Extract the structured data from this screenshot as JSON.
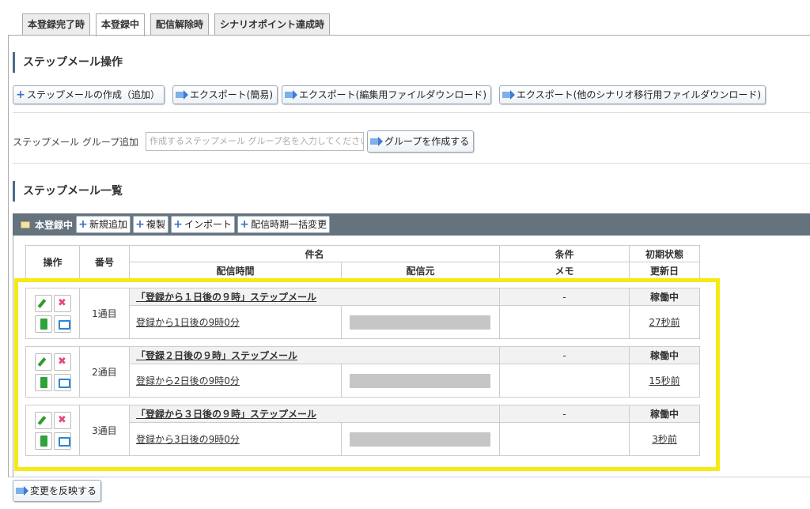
{
  "tabs": [
    "本登録完了時",
    "本登録中",
    "配信解除時",
    "シナリオポイント達成時"
  ],
  "active_tab": "本登録中",
  "ops_section": {
    "title": "ステップメール操作",
    "create_btn": "ステップメールの作成（追加）",
    "export_simple_btn": "エクスポート(簡易)",
    "export_edit_btn": "エクスポート(編集用ファイルダウンロード)",
    "export_other_btn": "エクスポート(他のシナリオ移行用ファイルダウンロード)"
  },
  "group": {
    "label": "ステップメール グループ追加",
    "placeholder": "作成するステップメール グループ名を入力してください",
    "create_btn": "グループを作成する"
  },
  "list_section": {
    "title": "ステップメール一覧",
    "group_name": "本登録中",
    "add_btn": "新規追加",
    "copy_btn": "複製",
    "import_btn": "インポート",
    "bulk_btn": "配信時期一括変更"
  },
  "table": {
    "h_ops": "操作",
    "h_num": "番号",
    "h_subject": "件名",
    "h_cond": "条件",
    "h_init": "初期状態",
    "h_time": "配信時間",
    "h_from": "配信元",
    "h_memo": "メモ",
    "h_updated": "更新日",
    "rows": [
      {
        "num": "1通目",
        "subject": "「登録から１日後の９時」ステップメール",
        "cond": "-",
        "status": "稼働中",
        "time": "登録から1日後の9時0分",
        "updated": "27秒前"
      },
      {
        "num": "2通目",
        "subject": "「登録２日後の９時」ステップメール",
        "cond": "-",
        "status": "稼働中",
        "time": "登録から2日後の9時0分",
        "updated": "15秒前"
      },
      {
        "num": "3通目",
        "subject": "「登録から３日後の９時」ステップメール",
        "cond": "-",
        "status": "稼働中",
        "time": "登録から3日後の9時0分",
        "updated": "3秒前"
      }
    ]
  },
  "reflect_btn": "変更を反映する"
}
